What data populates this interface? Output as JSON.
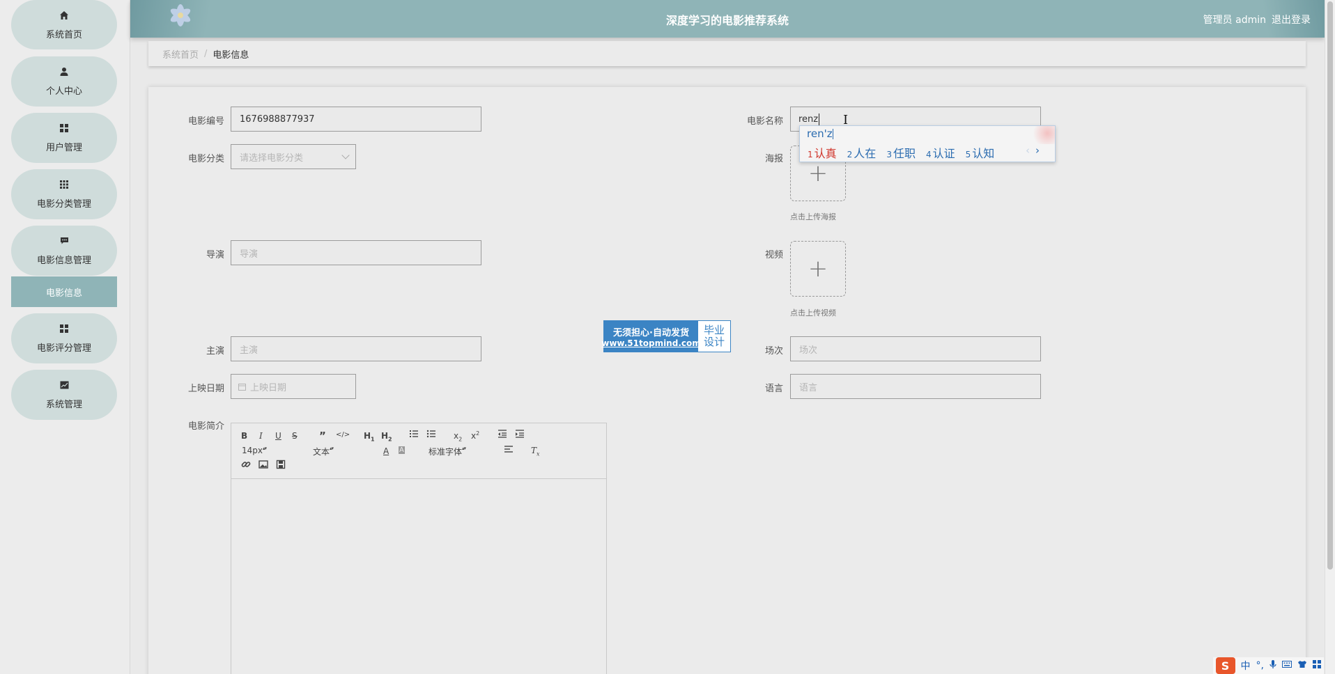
{
  "header": {
    "title": "深度学习的电影推荐系统",
    "user_label": "管理员 admin",
    "logout_label": "退出登录"
  },
  "sidebar": {
    "items": [
      {
        "label": "系统首页",
        "icon": "home-icon"
      },
      {
        "label": "个人中心",
        "icon": "user-icon"
      },
      {
        "label": "用户管理",
        "icon": "grid-icon"
      },
      {
        "label": "电影分类管理",
        "icon": "apps-icon"
      },
      {
        "label": "电影信息管理",
        "icon": "comment-icon"
      },
      {
        "label": "电影评分管理",
        "icon": "grid-icon"
      },
      {
        "label": "系统管理",
        "icon": "chart-icon"
      }
    ],
    "sub_item": "电影信息",
    "accent_color": "#8fb4b7"
  },
  "breadcrumb": {
    "home": "系统首页",
    "separator": "/",
    "current": "电影信息"
  },
  "form": {
    "movie_id": {
      "label": "电影编号",
      "value": "1676988877937"
    },
    "movie_name": {
      "label": "电影名称",
      "value": "renz"
    },
    "category": {
      "label": "电影分类",
      "placeholder": "请选择电影分类"
    },
    "poster": {
      "label": "海报",
      "hint": "点击上传海报"
    },
    "director": {
      "label": "导演",
      "placeholder": "导演"
    },
    "video": {
      "label": "视频",
      "hint": "点击上传视频"
    },
    "actors": {
      "label": "主演",
      "placeholder": "主演"
    },
    "session": {
      "label": "场次",
      "placeholder": "场次"
    },
    "release_date": {
      "label": "上映日期",
      "placeholder": "上映日期"
    },
    "language": {
      "label": "语言",
      "placeholder": "语言"
    },
    "intro": {
      "label": "电影简介"
    }
  },
  "editor": {
    "font_size": "14px",
    "text_type": "文本",
    "font_family": "标准字体"
  },
  "ime": {
    "composition": "ren'z",
    "candidates": [
      {
        "n": "1",
        "text": "认真"
      },
      {
        "n": "2",
        "text": "人在"
      },
      {
        "n": "3",
        "text": "任职"
      },
      {
        "n": "4",
        "text": "认证"
      },
      {
        "n": "5",
        "text": "认知"
      }
    ]
  },
  "watermark": {
    "line1": "无须担心·自动发货",
    "line2": "www.51topmind.com",
    "right1": "毕业",
    "right2": "设计"
  },
  "tray": {
    "logo": "S",
    "mode": "中"
  }
}
